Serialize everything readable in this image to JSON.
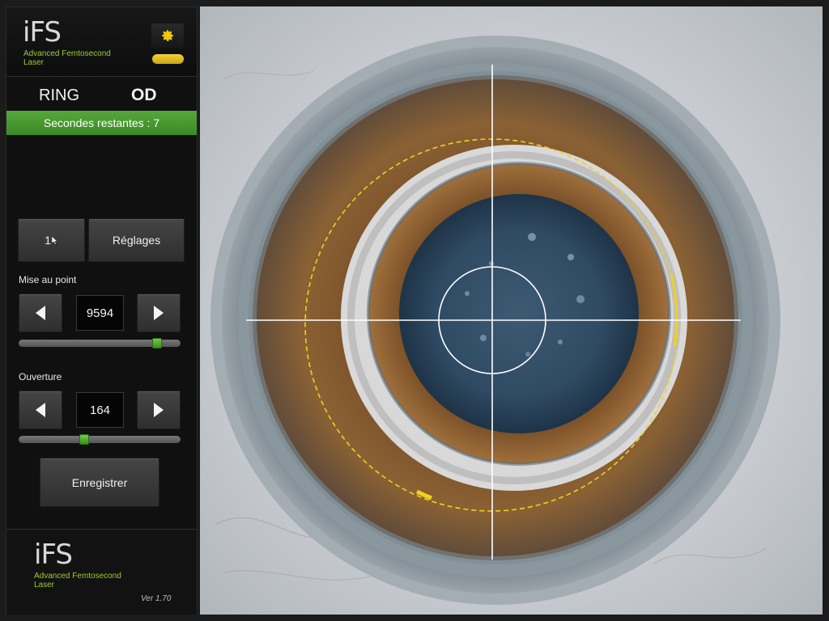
{
  "brand": {
    "logo": "iFS",
    "tagline": "Advanced Femtosecond Laser"
  },
  "header": {
    "mode": "RING",
    "eye": "OD"
  },
  "status": {
    "text": "Secondes restantes : 7",
    "color": "#4a9c30"
  },
  "controls": {
    "left_button_label": "1",
    "settings_label": "Réglages",
    "focus": {
      "label": "Mise au point",
      "value": "9594",
      "slider_fraction": 0.88
    },
    "aperture": {
      "label": "Ouverture",
      "value": "164",
      "slider_fraction": 0.4
    },
    "save_label": "Enregistrer"
  },
  "footer": {
    "logo": "iFS",
    "tagline": "Advanced Femtosecond Laser",
    "version": "Ver  1.70"
  },
  "icons": {
    "settings": "gear-icon",
    "prev": "arrow-left-icon",
    "next": "arrow-right-icon"
  },
  "colors": {
    "accent_green": "#9acd32",
    "indicator_yellow": "#e6c52a",
    "reticle_yellow": "#f0d020"
  }
}
